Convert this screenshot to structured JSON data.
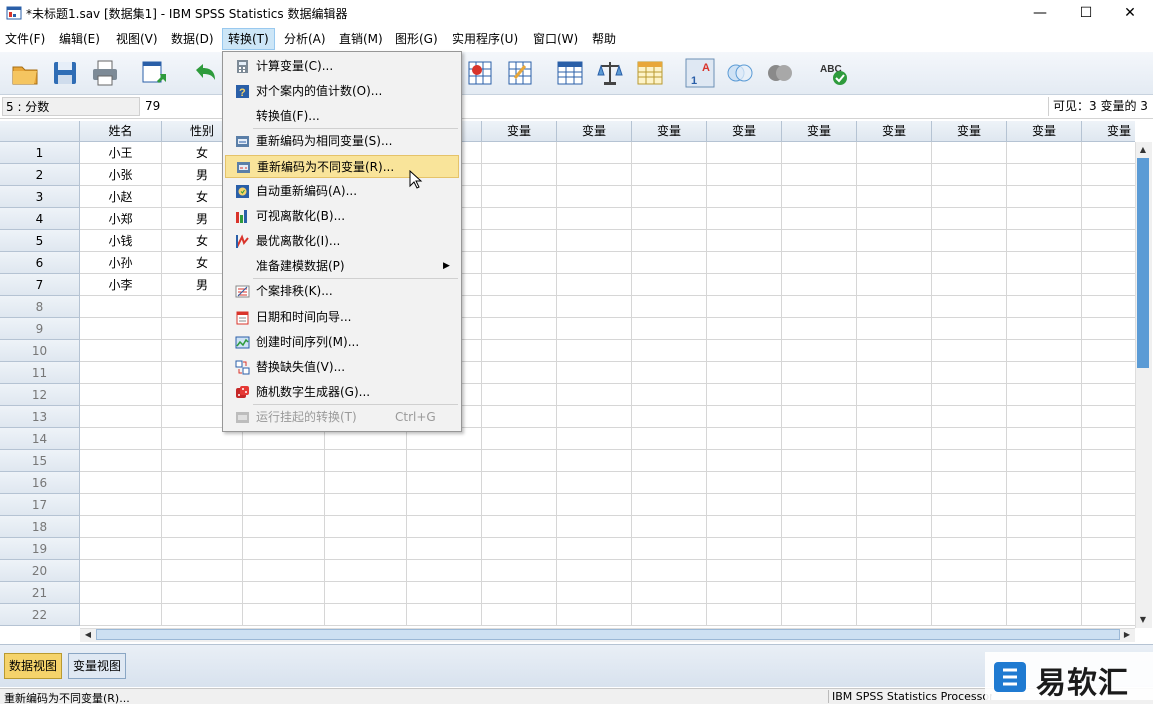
{
  "window": {
    "title": "*未标题1.sav [数据集1] - IBM SPSS Statistics 数据编辑器",
    "minimize": "—",
    "maximize": "☐",
    "close": "✕"
  },
  "menubar": [
    {
      "label": "文件(F)"
    },
    {
      "label": "编辑(E)"
    },
    {
      "label": "视图(V)"
    },
    {
      "label": "数据(D)"
    },
    {
      "label": "转换(T)"
    },
    {
      "label": "分析(A)"
    },
    {
      "label": "直销(M)"
    },
    {
      "label": "图形(G)"
    },
    {
      "label": "实用程序(U)"
    },
    {
      "label": "窗口(W)"
    },
    {
      "label": "帮助"
    }
  ],
  "infobar": {
    "cell_ref": "5 : 分数",
    "cell_value": "79",
    "visible": "可见：3 变量的 3"
  },
  "grid": {
    "columns": [
      "姓名",
      "性别",
      "",
      "",
      "",
      "变量",
      "变量",
      "变量",
      "变量",
      "变量",
      "变量",
      "变量",
      "变量",
      "变量"
    ],
    "row_numbers": [
      "1",
      "2",
      "3",
      "4",
      "5",
      "6",
      "7",
      "8",
      "9",
      "10",
      "11",
      "12",
      "13",
      "14",
      "15",
      "16",
      "17",
      "18",
      "19",
      "20",
      "21",
      "22"
    ],
    "rows": [
      [
        "小王",
        "女"
      ],
      [
        "小张",
        "男"
      ],
      [
        "小赵",
        "女"
      ],
      [
        "小郑",
        "男"
      ],
      [
        "小钱",
        "女"
      ],
      [
        "小孙",
        "女"
      ],
      [
        "小李",
        "男"
      ]
    ]
  },
  "dropdown": {
    "items": [
      {
        "label": "计算变量(C)...",
        "icon": "calculator-icon"
      },
      {
        "label": "对个案内的值计数(O)...",
        "icon": "count-icon"
      },
      {
        "label": "转换值(F)...",
        "icon": ""
      },
      {
        "label": "重新编码为相同变量(S)...",
        "icon": "recode-same-icon"
      },
      {
        "label": "重新编码为不同变量(R)...",
        "icon": "recode-different-icon"
      },
      {
        "label": "自动重新编码(A)...",
        "icon": "auto-recode-icon"
      },
      {
        "label": "可视离散化(B)...",
        "icon": "visual-binning-icon"
      },
      {
        "label": "最优离散化(I)...",
        "icon": "optimal-binning-icon"
      },
      {
        "label": "准备建模数据(P)",
        "icon": ""
      },
      {
        "label": "个案排秩(K)...",
        "icon": "rank-cases-icon"
      },
      {
        "label": "日期和时间向导...",
        "icon": "calendar-icon"
      },
      {
        "label": "创建时间序列(M)...",
        "icon": "time-series-icon"
      },
      {
        "label": "替换缺失值(V)...",
        "icon": "replace-missing-icon"
      },
      {
        "label": "随机数字生成器(G)...",
        "icon": "dice-icon"
      },
      {
        "label": "运行挂起的转换(T)",
        "icon": "run-pending-icon",
        "shortcut": "Ctrl+G"
      }
    ]
  },
  "tabs": {
    "data_view": "数据视图",
    "variable_view": "变量视图"
  },
  "statusbar": {
    "left": "重新编码为不同变量(R)...",
    "right": "IBM SPSS Statistics Processor"
  },
  "watermark": {
    "text": "易软汇"
  },
  "colors": {
    "highlight": "#f9e49a",
    "active_tab": "#f5d36b",
    "scroll_thumb": "#5b9bd5"
  }
}
